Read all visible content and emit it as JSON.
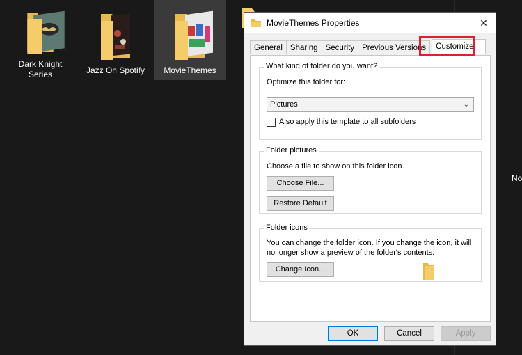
{
  "desktop": {
    "folders": [
      {
        "label": "Dark Knight Series",
        "icon": "folder-batman-thumbnail-icon"
      },
      {
        "label": "Jazz On Spotify",
        "icon": "folder-jazz-thumbnail-icon"
      },
      {
        "label": "MovieThemes",
        "icon": "folder-movie-thumbnail-icon",
        "selected": true
      }
    ],
    "edge_text": "No"
  },
  "dialog": {
    "title": "MovieThemes Properties",
    "close_symbol": "✕",
    "tabs": [
      {
        "label": "General"
      },
      {
        "label": "Sharing"
      },
      {
        "label": "Security"
      },
      {
        "label": "Previous Versions"
      },
      {
        "label": "Customize",
        "active": true
      }
    ],
    "folder_type": {
      "legend": "What kind of folder do you want?",
      "optimize_label": "Optimize this folder for:",
      "selected_option": "Pictures",
      "apply_subfolders_label": "Also apply this template to all subfolders",
      "apply_subfolders_checked": false
    },
    "folder_pictures": {
      "legend": "Folder pictures",
      "description": "Choose a file to show on this folder icon.",
      "choose_file_label": "Choose File...",
      "restore_default_label": "Restore Default"
    },
    "folder_icons": {
      "legend": "Folder icons",
      "description_line1": "You can change the folder icon. If you change the icon, it will",
      "description_line2": "no longer show a preview of the folder's contents.",
      "change_icon_label": "Change Icon..."
    },
    "footer": {
      "ok_label": "OK",
      "cancel_label": "Cancel",
      "apply_label": "Apply",
      "apply_enabled": false
    }
  },
  "colors": {
    "desktop_bg": "#191919",
    "selection_bg": "#3a3a3a",
    "folder_yellow": "#f4cd6a",
    "highlight_red": "#e0202f",
    "accent_blue": "#0078d7"
  }
}
